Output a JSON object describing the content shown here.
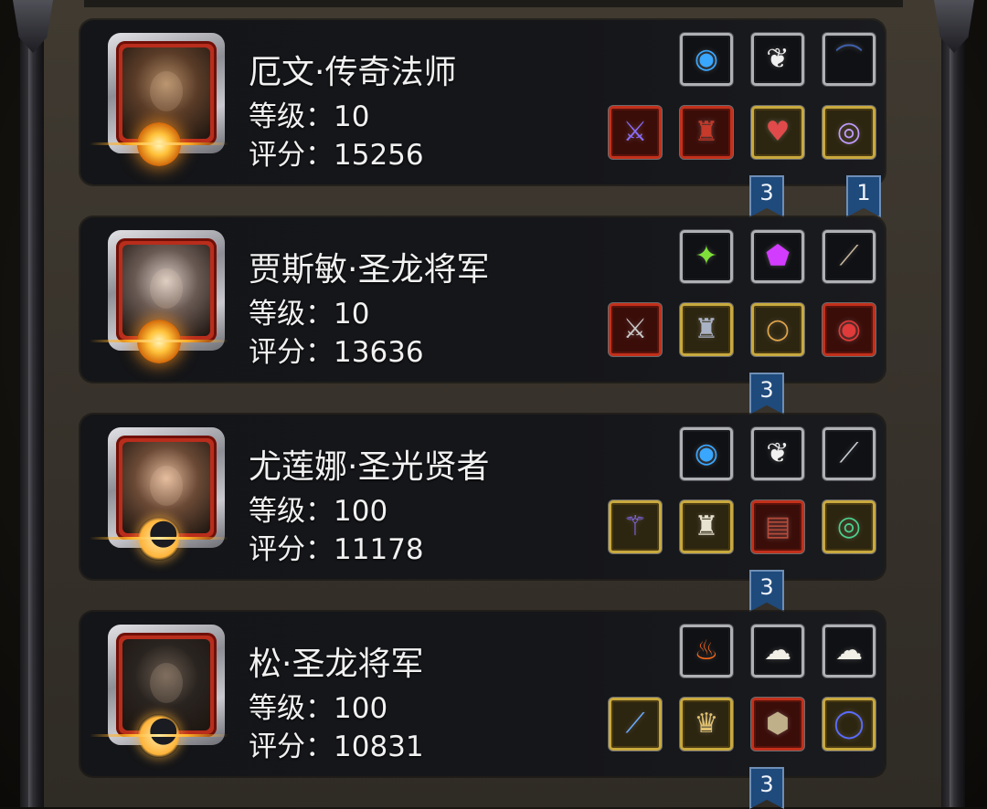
{
  "heroes": [
    {
      "name": "厄文·传奇法师",
      "level_label": "等级：",
      "level": "10",
      "score_label": "评分：",
      "score": "15256",
      "emblem": "sun-emblem",
      "slots_top": [
        {
          "icon": "orb-icon",
          "glyph": "◉",
          "color": "#3aa7ff"
        },
        {
          "icon": "wing-icon",
          "glyph": "❦",
          "color": "#f0f0f0"
        },
        {
          "icon": "bow-icon",
          "glyph": "⌒",
          "color": "#3d5ea8"
        }
      ],
      "slots_bottom": [
        {
          "icon": "staff-icon",
          "glyph": "⚔",
          "color": "#8a6cff"
        },
        {
          "icon": "cloak-icon",
          "glyph": "♜",
          "color": "#c53a2a"
        },
        {
          "icon": "amulet-icon",
          "glyph": "♥",
          "color": "#e04a4a"
        },
        {
          "icon": "eye-ring-icon",
          "glyph": "◎",
          "color": "#c19bff"
        }
      ],
      "badges": [
        "3",
        "1"
      ]
    },
    {
      "name": "贾斯敏·圣龙将军",
      "level_label": "等级：",
      "level": "10",
      "score_label": "评分：",
      "score": "13636",
      "emblem": "sun-emblem",
      "slots_top": [
        {
          "icon": "green-crystal-icon",
          "glyph": "✦",
          "color": "#7fe03a"
        },
        {
          "icon": "purple-gem-icon",
          "glyph": "⬟",
          "color": "#d23cff"
        },
        {
          "icon": "stick-icon",
          "glyph": "⟋",
          "color": "#c6b59a"
        }
      ],
      "slots_bottom": [
        {
          "icon": "sword-icon",
          "glyph": "⚔",
          "color": "#c8c8c8"
        },
        {
          "icon": "armor-icon",
          "glyph": "♜",
          "color": "#aab3c6"
        },
        {
          "icon": "ring-icon",
          "glyph": "○",
          "color": "#e0a54a"
        },
        {
          "icon": "red-ring-icon",
          "glyph": "◉",
          "color": "#e03a3a"
        }
      ],
      "badges": [
        "3"
      ]
    },
    {
      "name": "尤莲娜·圣光贤者",
      "level_label": "等级：",
      "level": "100",
      "score_label": "评分：",
      "score": "11178",
      "emblem": "moon-emblem",
      "slots_top": [
        {
          "icon": "orb-icon",
          "glyph": "◉",
          "color": "#3aa7ff"
        },
        {
          "icon": "wing-icon",
          "glyph": "❦",
          "color": "#f0f0f0"
        },
        {
          "icon": "dagger-icon",
          "glyph": "⟋",
          "color": "#c8ccd4"
        }
      ],
      "slots_bottom": [
        {
          "icon": "staff-icon",
          "glyph": "⚚",
          "color": "#8a6cff"
        },
        {
          "icon": "robe-icon",
          "glyph": "♜",
          "color": "#e8e2d0"
        },
        {
          "icon": "tome-icon",
          "glyph": "▤",
          "color": "#b44a3a"
        },
        {
          "icon": "necklace-icon",
          "glyph": "◎",
          "color": "#4ad08a"
        }
      ],
      "badges": [
        "3"
      ]
    },
    {
      "name": "松·圣龙将军",
      "level_label": "等级：",
      "level": "100",
      "score_label": "评分：",
      "score": "10831",
      "emblem": "moon-emblem",
      "slots_top": [
        {
          "icon": "flame-icon",
          "glyph": "♨",
          "color": "#ff6a1a"
        },
        {
          "icon": "fur-icon",
          "glyph": "☁",
          "color": "#f2efe6"
        },
        {
          "icon": "fur-icon",
          "glyph": "☁",
          "color": "#f2efe6"
        }
      ],
      "slots_bottom": [
        {
          "icon": "spear-icon",
          "glyph": "⟋",
          "color": "#6aa8ff"
        },
        {
          "icon": "helmet-icon",
          "glyph": "♛",
          "color": "#e0c070"
        },
        {
          "icon": "shield-icon",
          "glyph": "⬢",
          "color": "#c0b08a"
        },
        {
          "icon": "bracelet-icon",
          "glyph": "◯",
          "color": "#5a6cff"
        }
      ],
      "badges": [
        "3"
      ]
    }
  ]
}
